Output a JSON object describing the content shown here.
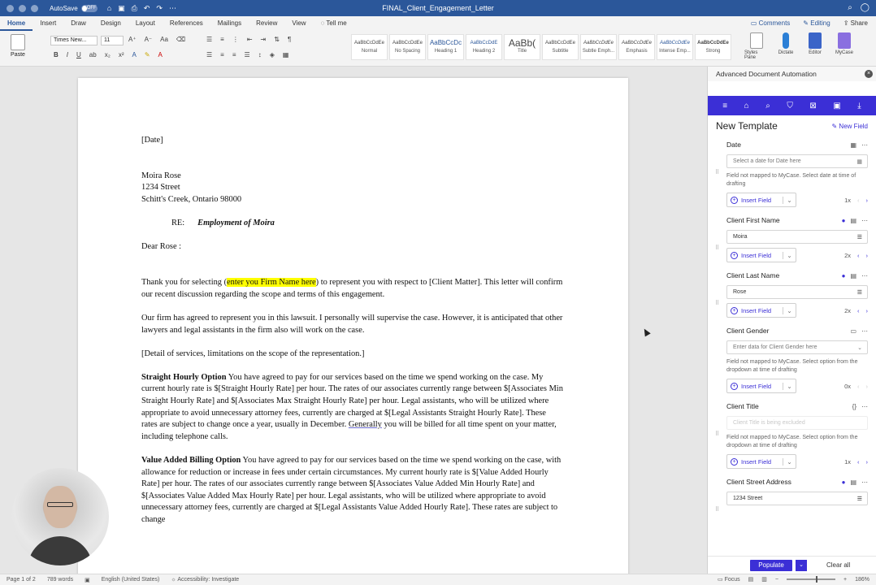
{
  "titlebar": {
    "autosave_label": "AutoSave",
    "autosave_state": "OFF",
    "document_title": "FINAL_Client_Engagement_Letter"
  },
  "tabs": [
    "Home",
    "Insert",
    "Draw",
    "Design",
    "Layout",
    "References",
    "Mailings",
    "Review",
    "View",
    "Tell me"
  ],
  "tabs_right": {
    "comments": "Comments",
    "editing": "Editing",
    "share": "Share"
  },
  "ribbon": {
    "paste_label": "Paste",
    "font_name": "Times New...",
    "font_size": "11",
    "styles": [
      {
        "sample": "AaBbCcDdEe",
        "label": "Normal"
      },
      {
        "sample": "AaBbCcDdEe",
        "label": "No Spacing"
      },
      {
        "sample": "AaBbCcDc",
        "label": "Heading 1"
      },
      {
        "sample": "AaBbCcDdE",
        "label": "Heading 2"
      },
      {
        "sample": "AaBb(",
        "label": "Title"
      },
      {
        "sample": "AaBbCcDdEe",
        "label": "Subtitle"
      },
      {
        "sample": "AaBbCcDdEe",
        "label": "Subtle Emph..."
      },
      {
        "sample": "AaBbCcDdEe",
        "label": "Emphasis"
      },
      {
        "sample": "AaBbCcDdEe",
        "label": "Intense Emp..."
      },
      {
        "sample": "AaBbCcDdEe",
        "label": "Strong"
      }
    ],
    "styles_pane": "Styles Pane",
    "dictate": "Dictate",
    "editor": "Editor",
    "mycase": "MyCase"
  },
  "document": {
    "date": "[Date]",
    "addr1": "Moira  Rose",
    "addr2": "1234 Street",
    "addr3": "Schitt's Creek, Ontario 98000",
    "re_label": "RE:",
    "re_text": "Employment of Moira",
    "salutation": "Dear  Rose :",
    "p1_a": "Thank you for selecting (",
    "p1_hl": "enter you Firm Name here",
    "p1_b": ") to represent you with respect to [Client Matter]. This letter will confirm our recent discussion regarding the scope and terms of this engagement.",
    "p2": "Our firm has agreed to represent you in this lawsuit. I personally will supervise the case. However, it is anticipated that other lawyers and legal assistants in the firm also will work on the case.",
    "p3": "[Detail of services, limitations on the scope of the representation.]",
    "p4_head": "Straight Hourly Option",
    "p4_a": " You have agreed to pay for our services based on the time we spend working on the case. My current hourly rate is $[Straight Hourly Rate] per hour. The rates of our associates currently range between $[Associates Min Straight Hourly Rate] and $[Associates Max Straight Hourly Rate] per hour. Legal assistants, who will be utilized where appropriate to avoid unnecessary attorney fees, currently are charged at $[Legal Assistants Straight Hourly Rate]. These rates are subject to change once a year, usually in December. ",
    "p4_ul": "Generally",
    "p4_b": " you will be billed for all time spent on your matter, including telephone calls.",
    "p5_head": "Value Added Billing Option",
    "p5_text": " You have agreed to pay for our services based on the time we spend working on the case, with allowance for reduction or increase in fees under certain circumstances. My current hourly rate is $[Value Added Hourly Rate] per hour. The rates of our associates currently range between $[Associates Value Added Min Hourly Rate] and $[Associates Value Added Max Hourly Rate] per hour. Legal assistants, who will be utilized where appropriate to avoid unnecessary attorney fees, currently are charged at $[Legal Assistants Value Added Hourly Rate]. These rates are subject to change"
  },
  "panel": {
    "header": "Advanced Document Automation",
    "title": "New Template",
    "new_field": "New Field",
    "insert_label": "Insert Field",
    "fields": [
      {
        "label": "Date",
        "input": "Select a date for Date here",
        "note": "Field not mapped to MyCase. Select date at time of drafting",
        "count": "1x"
      },
      {
        "label": "Client First Name",
        "input": "Moira",
        "note": "",
        "count": "2x"
      },
      {
        "label": "Client Last Name",
        "input": "Rose",
        "note": "",
        "count": "2x"
      },
      {
        "label": "Client Gender",
        "input": "Enter data for Client Gender here",
        "note": "Field not mapped to MyCase. Select option from the dropdown at time of drafting",
        "count": "0x"
      },
      {
        "label": "Client Title",
        "input": "Client Title is being excluded",
        "note": "Field not mapped to MyCase. Select option from the dropdown at time of drafting",
        "count": "1x"
      },
      {
        "label": "Client Street Address",
        "input": "1234 Street",
        "note": "",
        "count": ""
      }
    ],
    "populate": "Populate",
    "clear_all": "Clear all"
  },
  "status": {
    "page": "Page 1 of 2",
    "words": "789 words",
    "language": "English (United States)",
    "accessibility": "Accessibility: Investigate",
    "focus": "Focus",
    "zoom": "186%"
  }
}
